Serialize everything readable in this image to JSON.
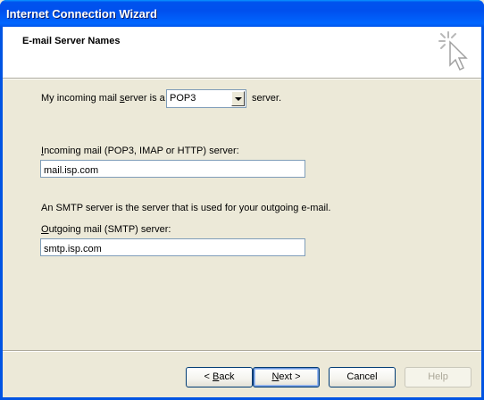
{
  "window": {
    "title": "Internet Connection Wizard"
  },
  "header": {
    "title": "E-mail Server Names",
    "icon": "wizard-wand-cursor-icon"
  },
  "form": {
    "incoming_type_prefix": "My incoming mail ",
    "incoming_type_access": "s",
    "incoming_type_rest": "erver is a",
    "incoming_type_value": "POP3",
    "incoming_type_suffix": "server.",
    "incoming_label_access": "I",
    "incoming_label_rest": "ncoming mail (POP3, IMAP or HTTP) server:",
    "incoming_value": "mail.isp.com",
    "smtp_note": "An SMTP server is the server that is used for your outgoing e-mail.",
    "outgoing_label_access": "O",
    "outgoing_label_rest": "utgoing mail (SMTP) server:",
    "outgoing_value": "smtp.isp.com"
  },
  "buttons": {
    "back_prefix": "< ",
    "back_access": "B",
    "back_rest": "ack",
    "next_access": "N",
    "next_rest": "ext >",
    "cancel": "Cancel",
    "help": "Help"
  },
  "colors": {
    "titlebar": "#0054e3",
    "face": "#ece9d8",
    "field_border": "#7f9db9"
  }
}
